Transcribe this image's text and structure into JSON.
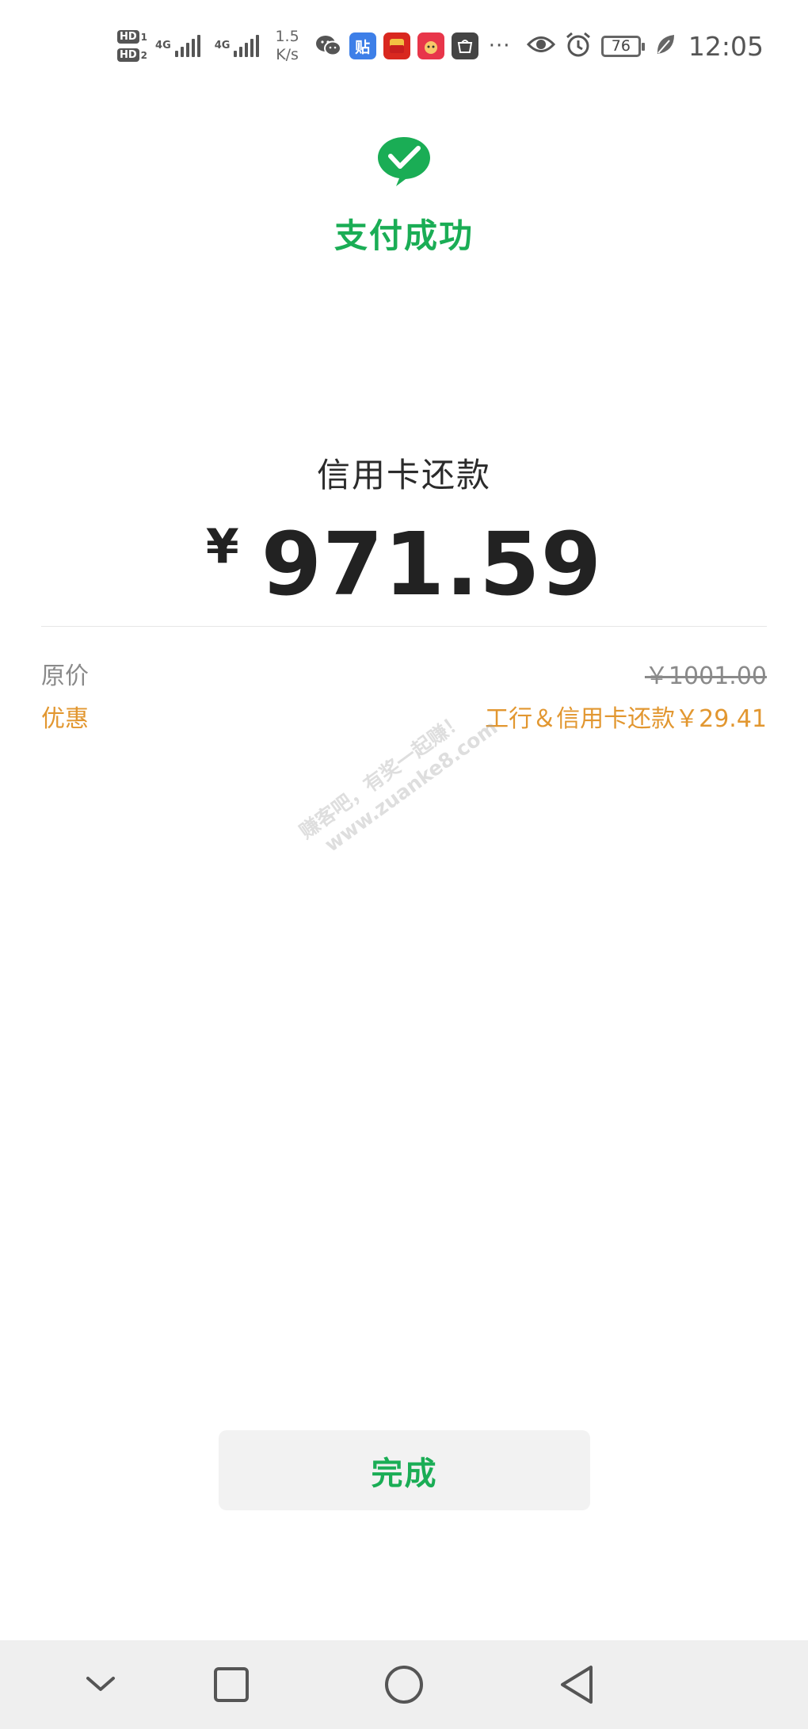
{
  "status_bar": {
    "hd1": "HD",
    "hd1_sub": "1",
    "hd2": "HD",
    "hd2_sub": "2",
    "signal1_label": "4G",
    "signal2_label": "4G",
    "net_speed_value": "1.5",
    "net_speed_unit": "K/s",
    "app_icons": [
      "wechat-icon",
      "tieba-icon",
      "red-envelope-app-icon",
      "red-app-icon",
      "huawei-app-icon"
    ],
    "tie_glyph": "贴",
    "more": "···",
    "battery": "76",
    "time": "12:05"
  },
  "header": {
    "title": "支付成功"
  },
  "payment": {
    "description": "信用卡还款",
    "currency_symbol": "¥",
    "amount": "971.59",
    "original_label": "原价",
    "original_value": "￥1001.00",
    "discount_label": "优惠",
    "discount_value": "工行＆信用卡还款￥29.41"
  },
  "watermark": {
    "line1": "赚客吧，有奖一起赚！",
    "line2": "www.zuanke8.com"
  },
  "actions": {
    "done_label": "完成"
  },
  "colors": {
    "accent_green": "#1aad55",
    "discount_orange": "#e29730",
    "muted_gray": "#8a8a8a",
    "button_bg": "#f2f2f2",
    "navbar_bg": "#efefef"
  },
  "nav": {
    "icons": [
      "chevron-down-icon",
      "square-recents-icon",
      "circle-home-icon",
      "triangle-back-icon"
    ]
  }
}
